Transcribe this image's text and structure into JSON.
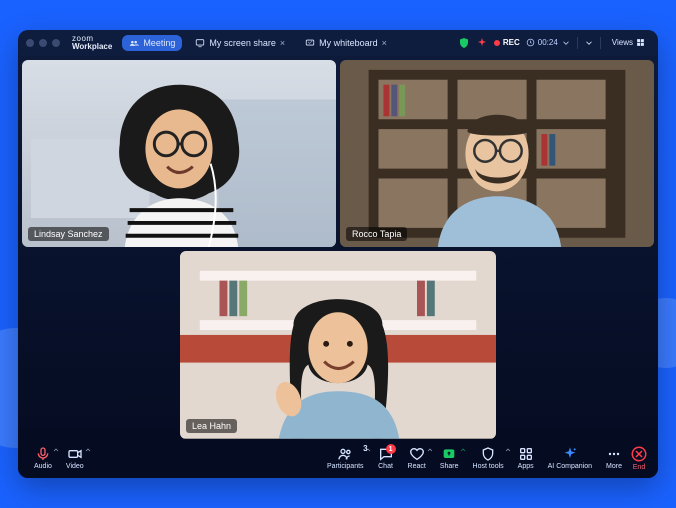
{
  "brand": {
    "line1": "zoom",
    "line2": "Workplace"
  },
  "tabs": [
    {
      "icon": "meeting-icon",
      "label": "Meeting",
      "active": true,
      "closable": false
    },
    {
      "icon": "screen-share-icon",
      "label": "My screen share",
      "active": false,
      "closable": true
    },
    {
      "icon": "whiteboard-icon",
      "label": "My whiteboard",
      "active": false,
      "closable": true
    }
  ],
  "status": {
    "rec_label": "REC",
    "timer": "00:24",
    "views_label": "Views"
  },
  "participants": [
    {
      "name": "Lindsay Sanchez"
    },
    {
      "name": "Rocco Tapia"
    },
    {
      "name": "Lea Hahn"
    }
  ],
  "toolbar": {
    "audio": "Audio",
    "video": "Video",
    "participants": "Participants",
    "participants_count": "3",
    "chat": "Chat",
    "chat_badge": "1",
    "react": "React",
    "share": "Share",
    "host_tools": "Host tools",
    "apps": "Apps",
    "ai_companion": "AI Companion",
    "more": "More",
    "end": "End"
  }
}
